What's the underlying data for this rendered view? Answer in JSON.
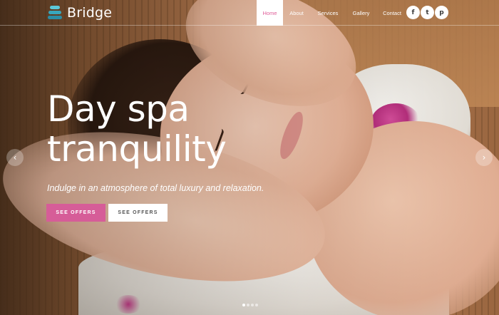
{
  "brand": {
    "name": "Bridge",
    "accent": "#d65d98",
    "logo_color": "#3fb6c9"
  },
  "nav": {
    "items": [
      {
        "label": "Home",
        "active": true
      },
      {
        "label": "About",
        "active": false
      },
      {
        "label": "Services",
        "active": false
      },
      {
        "label": "Gallery",
        "active": false
      },
      {
        "label": "Contact",
        "active": false
      }
    ]
  },
  "social": [
    {
      "icon": "facebook-icon",
      "glyph": "f"
    },
    {
      "icon": "twitter-icon",
      "glyph": "t"
    },
    {
      "icon": "pinterest-icon",
      "glyph": "p"
    }
  ],
  "hero": {
    "headline_line1": "Day spa",
    "headline_line2": "tranquility",
    "subtitle": "Indulge in an atmosphere of total luxury and relaxation.",
    "primary_button": "SEE OFFERS",
    "secondary_button": "SEE OFFERS"
  },
  "slider": {
    "prev_icon": "chevron-left-icon",
    "next_icon": "chevron-right-icon",
    "prev_glyph": "‹",
    "next_glyph": "›",
    "slide_count": 4,
    "active_slide": 1
  }
}
